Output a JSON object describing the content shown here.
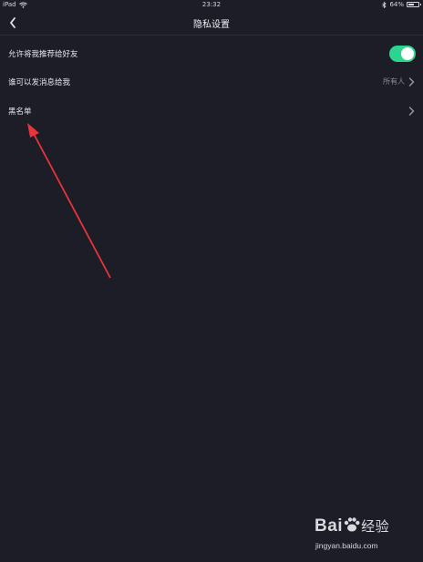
{
  "status_bar": {
    "device": "iPad",
    "time": "23:32",
    "battery": "64%",
    "battery_level": 0.64
  },
  "nav": {
    "title": "隐私设置"
  },
  "settings": {
    "recommend_friends": {
      "label": "允许将我推荐给好友",
      "enabled": true
    },
    "who_can_message": {
      "label": "谁可以发消息给我",
      "value": "所有人"
    },
    "blacklist": {
      "label": "黑名单"
    }
  },
  "watermark": {
    "brand": "Bai",
    "brand_suffix": "经验",
    "url": "jingyan.baidu.com"
  },
  "colors": {
    "background": "#1c1d27",
    "toggle_on": "#2cd58f",
    "annotation_arrow": "#e8343a"
  },
  "icons": {
    "back": "chevron-left-icon",
    "row_chevron": "chevron-right-icon",
    "wifi": "wifi-icon",
    "bluetooth": "bluetooth-icon",
    "battery": "battery-icon"
  }
}
